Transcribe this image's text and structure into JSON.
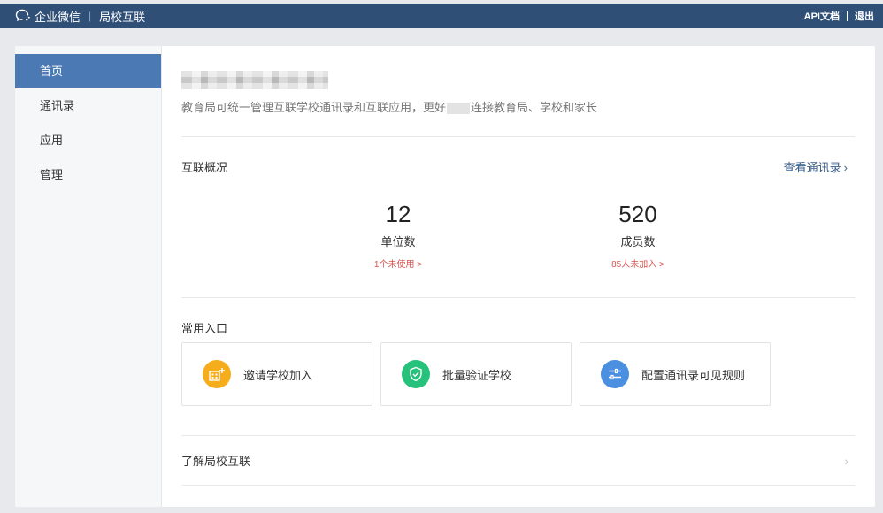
{
  "header": {
    "brand_name": "企业微信",
    "product_name": "局校互联",
    "links": [
      "API文档",
      "退出"
    ]
  },
  "sidebar": {
    "items": [
      {
        "label": "首页",
        "active": true
      },
      {
        "label": "通讯录",
        "active": false
      },
      {
        "label": "应用",
        "active": false
      },
      {
        "label": "管理",
        "active": false
      }
    ]
  },
  "main": {
    "intro_part1": "教育局可统一管理互联学校通讯录和互联应用，更好",
    "intro_part2": "连接教育局、学校和家长",
    "overview": {
      "title": "互联概况",
      "view_link": "查看通讯录",
      "stats": [
        {
          "value": "12",
          "label": "单位数",
          "alert": "1个未使用 >"
        },
        {
          "value": "520",
          "label": "成员数",
          "alert": "85人未加入 >"
        }
      ]
    },
    "entries": {
      "title": "常用入口",
      "items": [
        {
          "label": "邀请学校加入",
          "icon": "invite-school-icon",
          "color": "#f5ad1b"
        },
        {
          "label": "批量验证学校",
          "icon": "shield-check-icon",
          "color": "#26c17a"
        },
        {
          "label": "配置通讯录可见规则",
          "icon": "sliders-icon",
          "color": "#4a8fe0"
        }
      ]
    },
    "learn_more": "了解局校互联"
  }
}
